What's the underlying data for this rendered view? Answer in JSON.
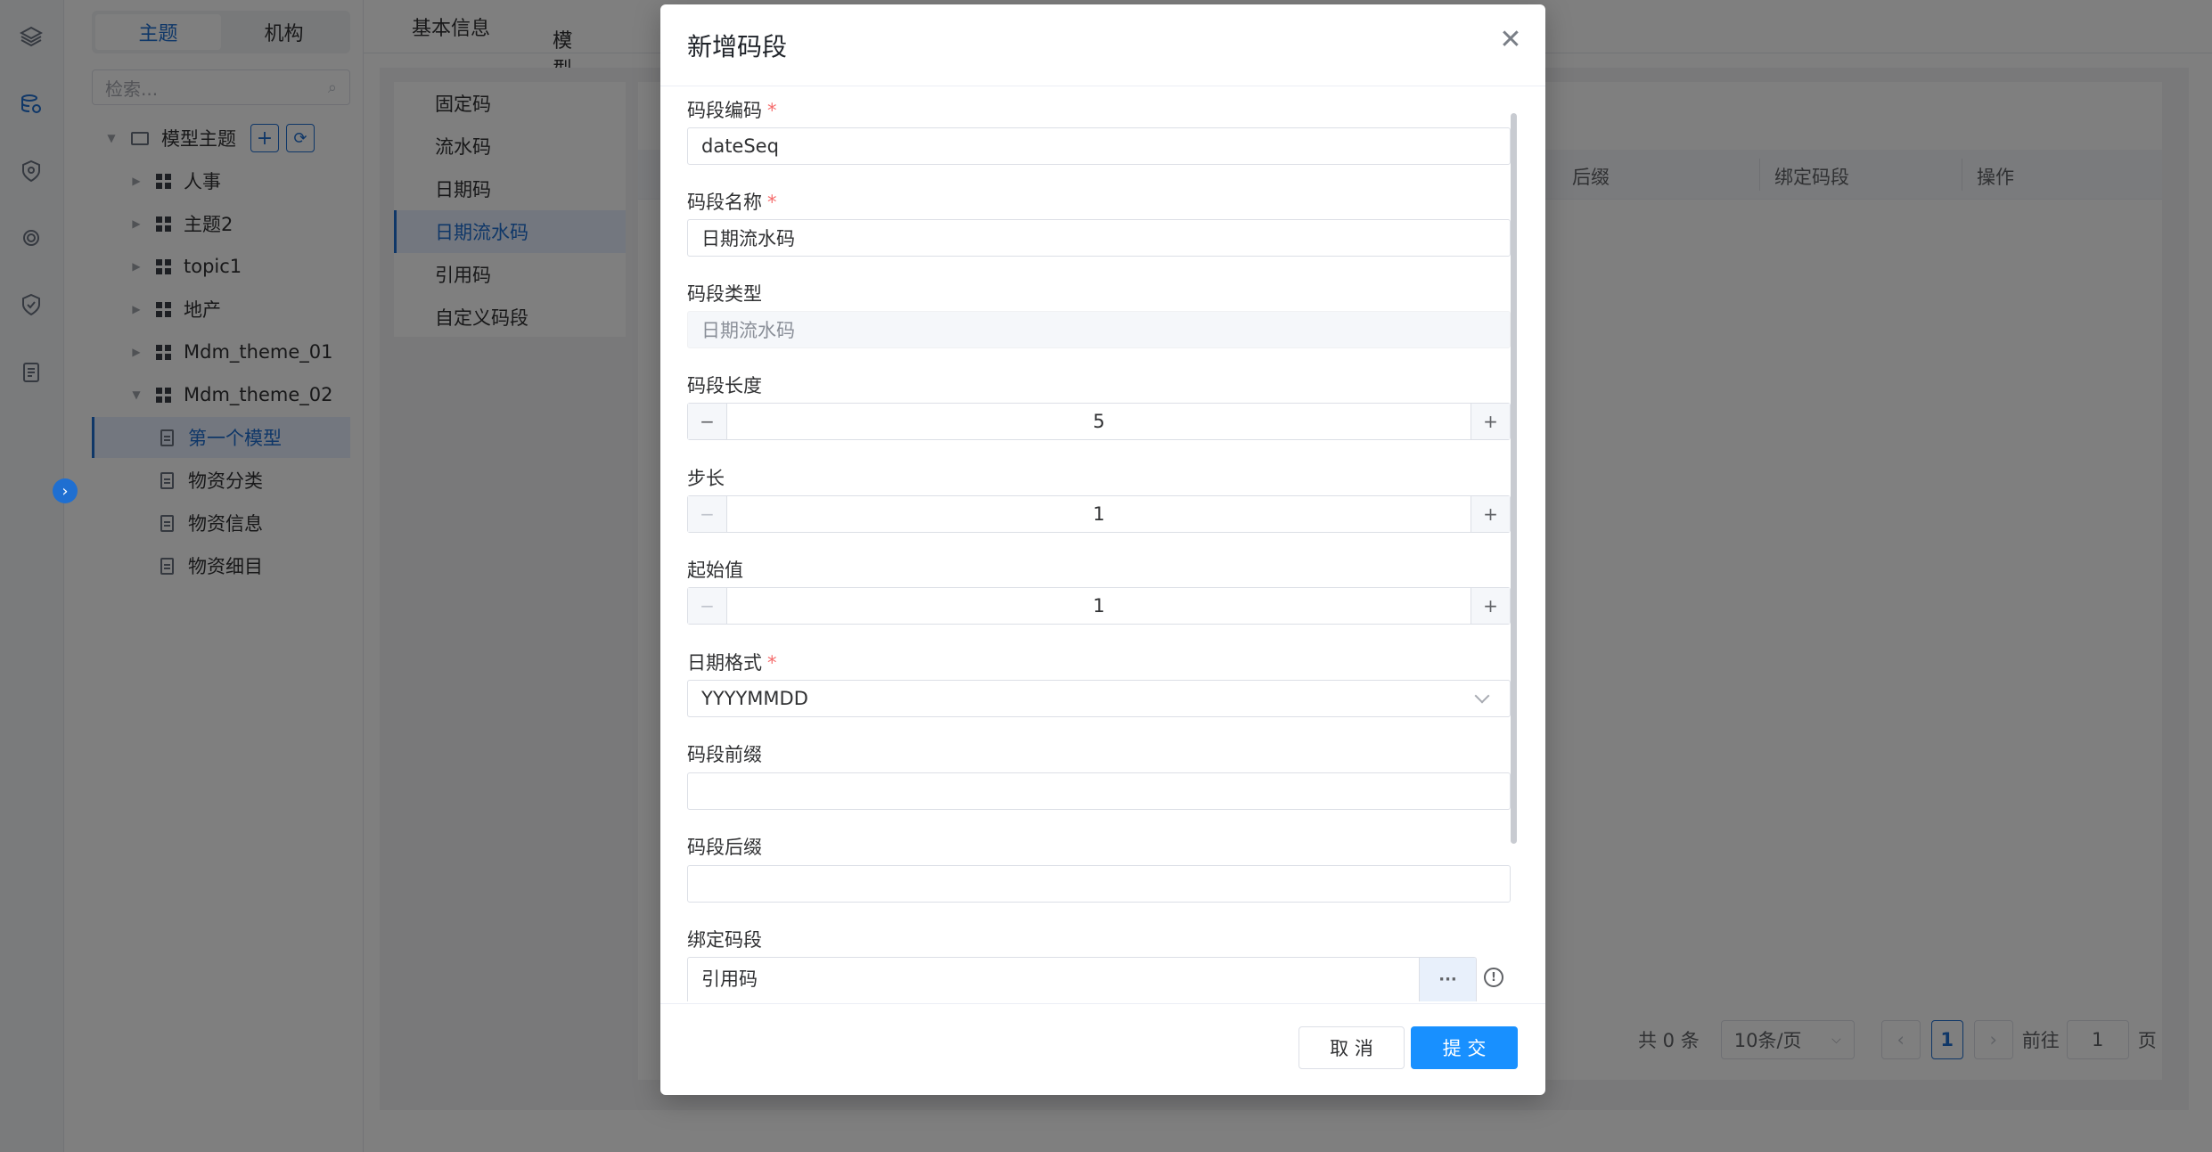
{
  "rail": {
    "icons": [
      "layers-icon",
      "database-icon",
      "shield-icon",
      "chip-icon",
      "security-icon",
      "document-icon"
    ]
  },
  "tree": {
    "segment_tabs": [
      "主题",
      "机构"
    ],
    "search_placeholder": "检索...",
    "root_label": "模型主题",
    "nodes": [
      "人事",
      "主题2",
      "topic1",
      "地产",
      "Mdm_theme_01",
      "Mdm_theme_02"
    ],
    "models": [
      "第一个模型",
      "物资分类",
      "物资信息",
      "物资细目"
    ]
  },
  "topnav": {
    "tab_basic": "基本信息",
    "tab_model_config": "模型配置"
  },
  "code_types": [
    "固定码",
    "流水码",
    "日期码",
    "日期流水码",
    "引用码",
    "自定义码段"
  ],
  "table": {
    "columns": [
      "后缀",
      "绑定码段",
      "操作"
    ]
  },
  "pager": {
    "total": "共 0 条",
    "page_size": "10条/页",
    "current_page": "1",
    "goto_label": "前往",
    "goto_value": "1",
    "page_suffix": "页"
  },
  "dialog": {
    "title": "新增码段",
    "fields": {
      "code_label": "码段编码",
      "code_value": "dateSeq",
      "name_label": "码段名称",
      "name_value": "日期流水码",
      "type_label": "码段类型",
      "type_value": "日期流水码",
      "length_label": "码段长度",
      "length_value": "5",
      "step_label": "步长",
      "step_value": "1",
      "start_label": "起始值",
      "start_value": "1",
      "date_format_label": "日期格式",
      "date_format_value": "YYYYMMDD",
      "prefix_label": "码段前缀",
      "prefix_value": "",
      "suffix_label": "码段后缀",
      "suffix_value": "",
      "bind_label": "绑定码段",
      "bind_value": "引用码"
    },
    "required_mark": "*",
    "cancel_label": "取 消",
    "submit_label": "提 交"
  },
  "colors": {
    "primary": "#1890ff",
    "accent": "#1f6fd1",
    "required": "#f56c6c"
  }
}
